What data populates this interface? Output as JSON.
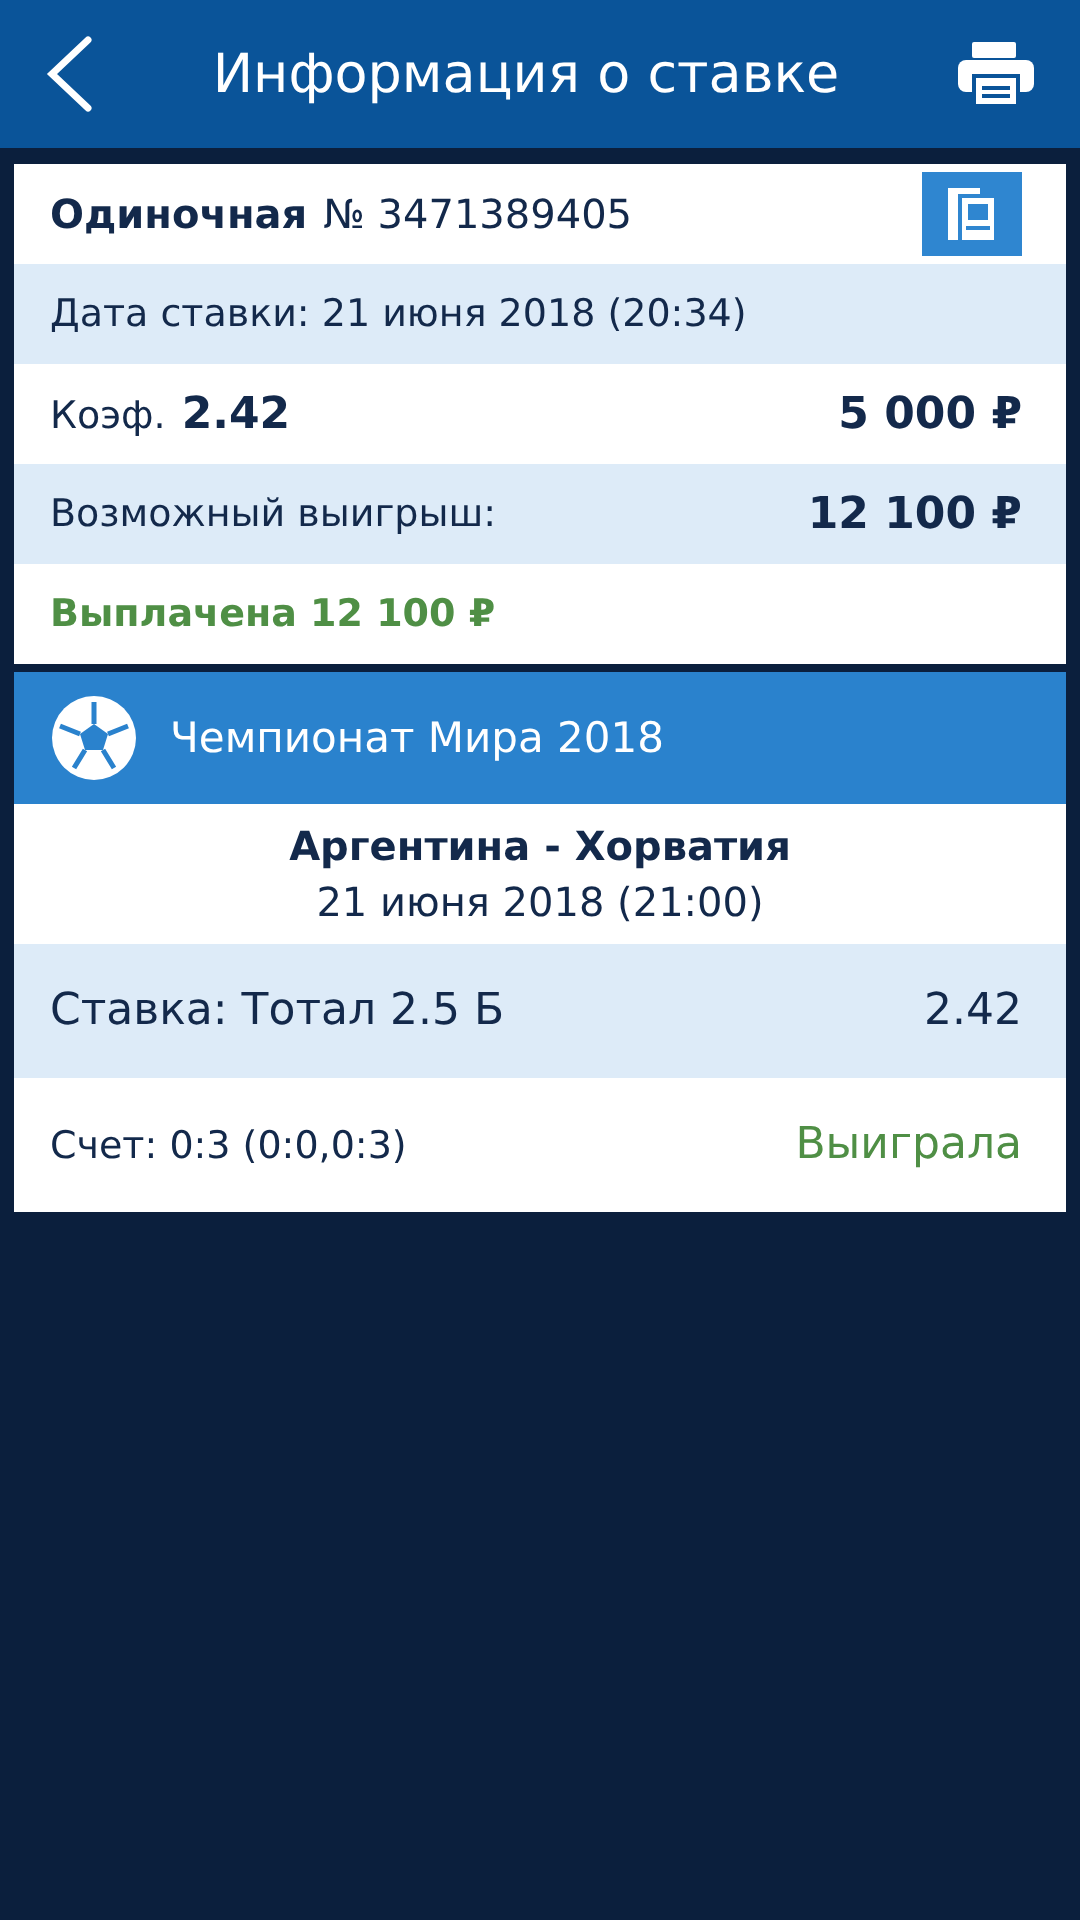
{
  "header": {
    "title": "Информация о ставке"
  },
  "bet": {
    "type": "Одиночная",
    "number": "№ 3471389405",
    "date": "Дата ставки: 21 июня 2018 (20:34)",
    "odds_label": "Коэф.",
    "odds": "2.42",
    "stake": "5 000 ₽",
    "win_label": "Возможный выигрыш:",
    "win": "12 100 ₽",
    "status": "Выплачена 12 100 ₽"
  },
  "event": {
    "tournament": "Чемпионат Мира 2018",
    "match": "Аргентина - Хорватия",
    "datetime": "21 июня 2018 (21:00)",
    "bet_label": "Ставка: Тотал 2.5 Б",
    "bet_odds": "2.42",
    "score": "Счет: 0:3 (0:0,0:3)",
    "result": "Выиграла"
  }
}
